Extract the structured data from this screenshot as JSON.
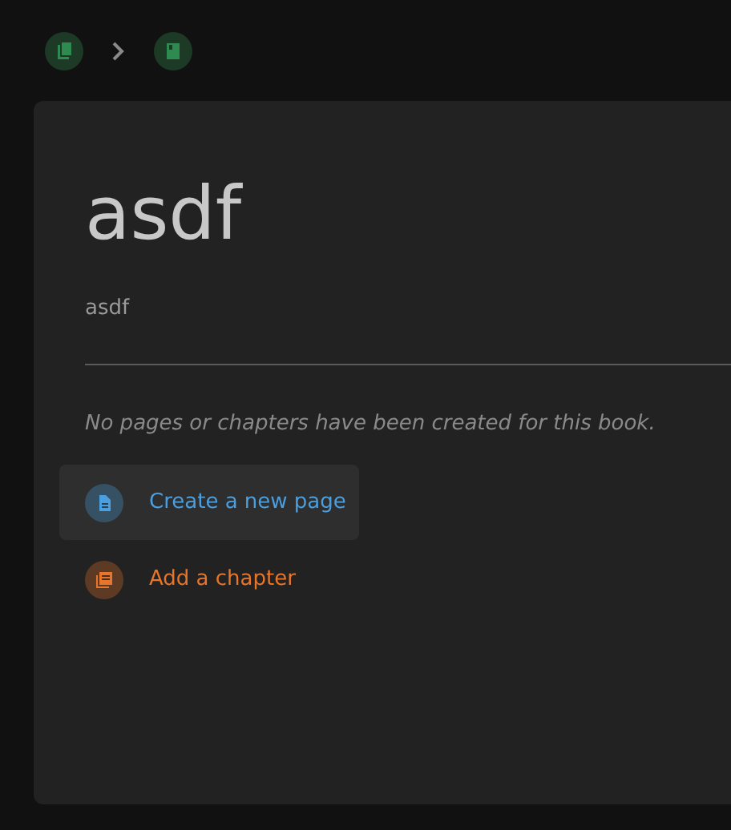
{
  "breadcrumbs": [
    {
      "kind": "shelf"
    },
    {
      "kind": "book"
    }
  ],
  "book": {
    "title": "asdf",
    "description": "asdf",
    "empty_message": "No pages or chapters have been created for this book."
  },
  "actions": [
    {
      "kind": "page",
      "label": "Create a new page",
      "color": "#4a9fe0",
      "selected": true
    },
    {
      "kind": "chapter",
      "label": "Add a chapter",
      "color": "#e8752a",
      "selected": false
    }
  ]
}
